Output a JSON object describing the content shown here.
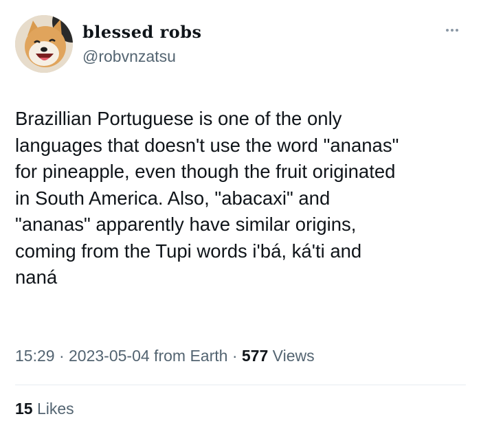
{
  "author": {
    "display_name": "blessed robs",
    "handle": "@robvnzatsu",
    "avatar_icon": "shiba-dog-avatar"
  },
  "tweet": {
    "text": "Brazillian Portuguese is one of the only\nlanguages that doesn't use the word \"ananas\"\nfor pineapple, even though the fruit originated\nin South America. Also, \"abacaxi\" and\n\"ananas\" apparently have similar origins,\ncoming from the Tupi words i'bá, ká'ti and\nnaná"
  },
  "meta": {
    "time": "15:29",
    "sep1": " · ",
    "date": "2023-05-04",
    "source": " from Earth",
    "sep2": " · ",
    "views_count": "577",
    "views_label": " Views"
  },
  "engagement": {
    "likes_count": "15",
    "likes_label": " Likes"
  },
  "colors": {
    "primary_text": "#0f1419",
    "secondary_text": "#536471",
    "divider": "#e6ecf0"
  },
  "icons": {
    "more": "more-options-icon"
  }
}
